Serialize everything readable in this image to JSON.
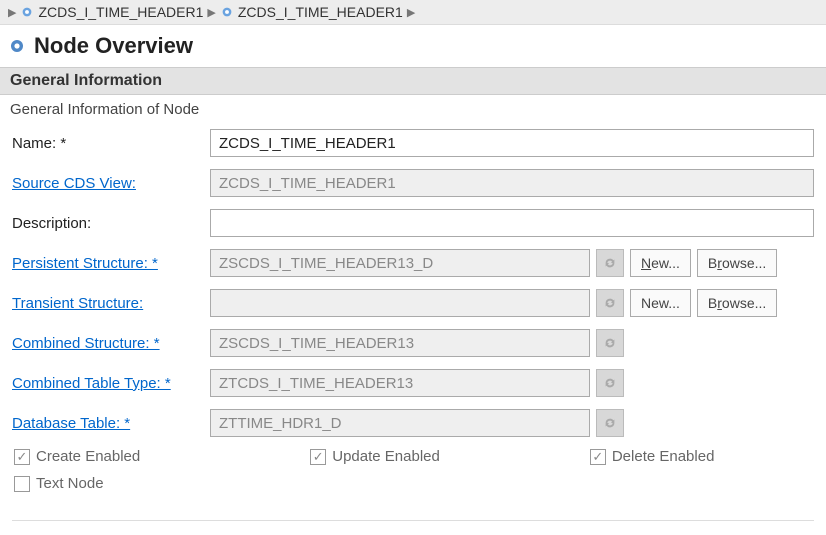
{
  "breadcrumb": {
    "items": [
      "ZCDS_I_TIME_HEADER1",
      "ZCDS_I_TIME_HEADER1"
    ]
  },
  "page": {
    "title": "Node Overview"
  },
  "section": {
    "header": "General Information",
    "desc": "General Information of Node"
  },
  "fields": {
    "name": {
      "label": "Name: *",
      "value": "ZCDS_I_TIME_HEADER1",
      "readonly": false
    },
    "source_cds_view": {
      "label": "Source CDS View:",
      "value": "ZCDS_I_TIME_HEADER1",
      "readonly": true,
      "link": true
    },
    "description": {
      "label": "Description:",
      "value": "",
      "readonly": false
    },
    "persistent_structure": {
      "label": "Persistent Structure: *",
      "value": "ZSCDS_I_TIME_HEADER13_D",
      "readonly": true,
      "link": true
    },
    "transient_structure": {
      "label": "Transient Structure:",
      "value": "",
      "readonly": true,
      "link": true
    },
    "combined_structure": {
      "label": "Combined Structure: *",
      "value": "ZSCDS_I_TIME_HEADER13",
      "readonly": true,
      "link": true
    },
    "combined_table_type": {
      "label": "Combined Table Type: *",
      "value": "ZTCDS_I_TIME_HEADER13",
      "readonly": true,
      "link": true
    },
    "database_table": {
      "label": "Database Table: *",
      "value": "ZTTIME_HDR1_D",
      "readonly": true,
      "link": true
    }
  },
  "buttons": {
    "new": "New...",
    "browse": "Browse..."
  },
  "checkboxes": {
    "create_enabled": {
      "label": "Create Enabled",
      "checked": true
    },
    "update_enabled": {
      "label": "Update Enabled",
      "checked": true
    },
    "delete_enabled": {
      "label": "Delete Enabled",
      "checked": true
    },
    "text_node": {
      "label": "Text Node",
      "checked": false
    }
  }
}
